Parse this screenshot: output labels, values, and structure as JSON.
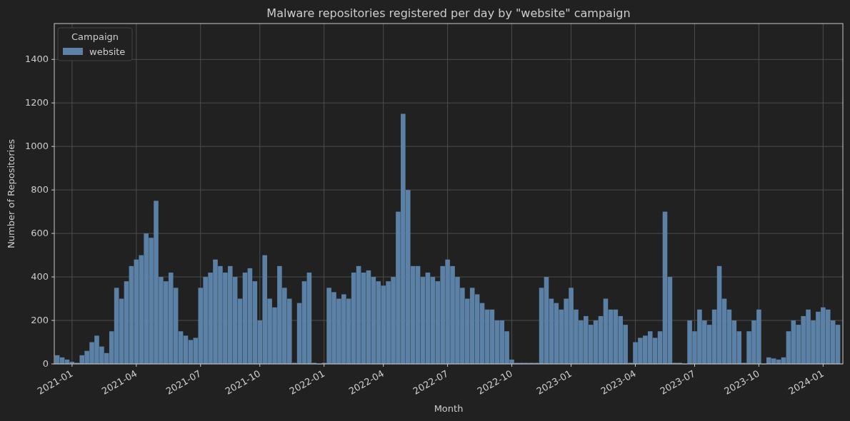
{
  "chart": {
    "legend": {
      "title": "Campaign"
    },
    "chart_data": {
      "type": "bar",
      "title": "Malware repositories registered per day by \"website\" campaign",
      "xlabel": "Month",
      "ylabel": "Number of Repositories",
      "categories": [
        null,
        null,
        null,
        "2021-01",
        null,
        null,
        null,
        null,
        null,
        null,
        null,
        null,
        null,
        null,
        null,
        null,
        "2021-04",
        null,
        null,
        null,
        null,
        null,
        null,
        null,
        null,
        null,
        null,
        null,
        null,
        "2021-07",
        null,
        null,
        null,
        null,
        null,
        null,
        null,
        null,
        null,
        null,
        null,
        "2021-10",
        null,
        null,
        null,
        null,
        null,
        null,
        null,
        null,
        null,
        null,
        null,
        null,
        "2022-01",
        null,
        null,
        null,
        null,
        null,
        null,
        null,
        null,
        null,
        null,
        null,
        "2022-04",
        null,
        null,
        null,
        null,
        null,
        null,
        null,
        null,
        null,
        null,
        null,
        null,
        "2022-07",
        null,
        null,
        null,
        null,
        null,
        null,
        null,
        null,
        null,
        null,
        null,
        null,
        "2022-10",
        null,
        null,
        null,
        null,
        null,
        null,
        null,
        null,
        null,
        null,
        null,
        "2023-01",
        null,
        null,
        null,
        null,
        null,
        null,
        null,
        null,
        null,
        null,
        null,
        null,
        "2023-04",
        null,
        null,
        null,
        null,
        null,
        null,
        null,
        null,
        null,
        null,
        null,
        "2023-07",
        null,
        null,
        null,
        null,
        null,
        null,
        null,
        null,
        null,
        null,
        null,
        null,
        "2023-10",
        null,
        null,
        null,
        null,
        null,
        null,
        null,
        null,
        null,
        null,
        null,
        null,
        "2024-01",
        null,
        null,
        null
      ],
      "series": [
        {
          "name": "website",
          "color": "#5b82a6",
          "values": [
            40,
            30,
            20,
            10,
            5,
            40,
            60,
            100,
            130,
            80,
            50,
            150,
            350,
            300,
            380,
            450,
            480,
            500,
            600,
            580,
            750,
            400,
            380,
            420,
            350,
            150,
            130,
            110,
            120,
            350,
            400,
            420,
            480,
            450,
            420,
            450,
            400,
            300,
            420,
            440,
            380,
            200,
            500,
            300,
            260,
            450,
            350,
            300,
            5,
            280,
            380,
            420,
            5,
            0,
            5,
            350,
            330,
            300,
            320,
            300,
            420,
            450,
            420,
            430,
            400,
            380,
            360,
            380,
            400,
            700,
            1150,
            800,
            450,
            450,
            400,
            420,
            400,
            380,
            450,
            480,
            450,
            400,
            350,
            300,
            350,
            320,
            280,
            250,
            250,
            200,
            200,
            150,
            20,
            5,
            5,
            5,
            5,
            5,
            350,
            400,
            300,
            280,
            250,
            300,
            350,
            250,
            200,
            220,
            180,
            200,
            220,
            300,
            250,
            250,
            220,
            180,
            5,
            100,
            120,
            130,
            150,
            120,
            150,
            700,
            400,
            5,
            5,
            0,
            200,
            150,
            250,
            200,
            180,
            250,
            450,
            300,
            250,
            200,
            150,
            5,
            150,
            200,
            250,
            0,
            30,
            25,
            20,
            30,
            150,
            200,
            180,
            220,
            250,
            200,
            240,
            260,
            250,
            200,
            180
          ]
        }
      ],
      "ylim": [
        0,
        1565
      ],
      "grid": true,
      "yticks": [
        0,
        200,
        400,
        600,
        800,
        1000,
        1200,
        1400
      ]
    }
  }
}
